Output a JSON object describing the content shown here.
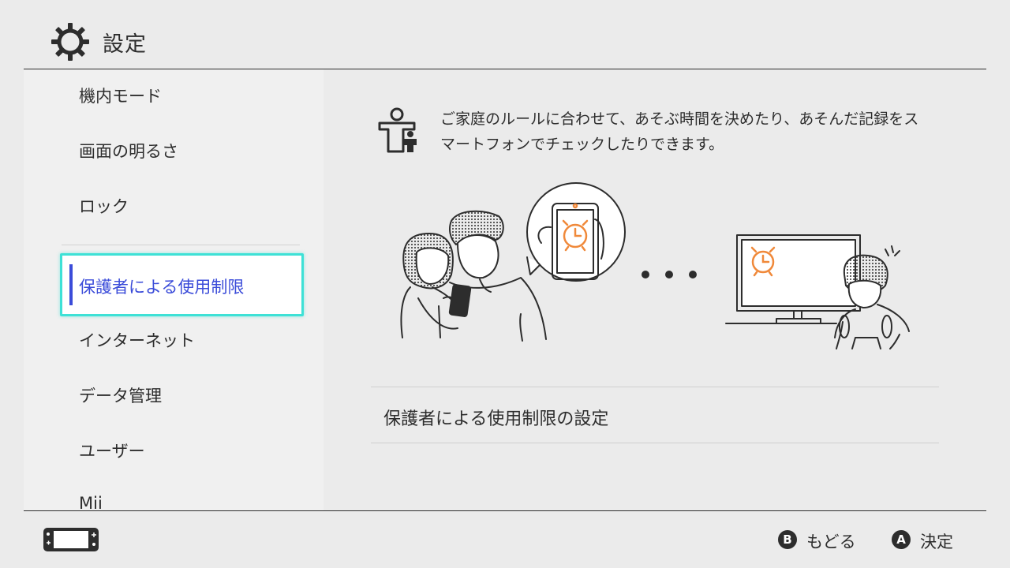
{
  "header": {
    "title": "設定",
    "icon": "gear-icon"
  },
  "sidebar": {
    "items": [
      {
        "label": "機内モード"
      },
      {
        "label": "画面の明るさ"
      },
      {
        "label": "ロック"
      },
      {
        "label": "保護者による使用制限",
        "selected": true
      },
      {
        "label": "インターネット"
      },
      {
        "label": "データ管理"
      },
      {
        "label": "ユーザー"
      },
      {
        "label": "Mii"
      }
    ]
  },
  "main": {
    "icon": "parental-controls-icon",
    "description": "ご家庭のルールに合わせて、あそぶ時間を決めたり、あそんだ記録をスマートフォンでチェックしたりできます。",
    "illustration_icon": "family-phone-alarm-illustration",
    "setting_row_label": "保護者による使用制限の設定"
  },
  "footer": {
    "console_icon": "console-icon",
    "back": {
      "button": "B",
      "label": "もどる"
    },
    "ok": {
      "button": "A",
      "label": "決定"
    }
  },
  "colors": {
    "background": "#ebebeb",
    "sidebar_background": "#f0f0f0",
    "selection_border": "#3ee1d6",
    "selection_accent": "#3b4cd9",
    "alarm_orange": "#f0893a",
    "text": "#2d2d2d"
  }
}
